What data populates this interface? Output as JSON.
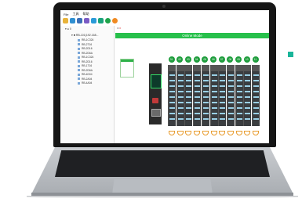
{
  "app": {
    "menu": [
      "File",
      "工具",
      "帮助"
    ],
    "toolbar_icons": [
      {
        "name": "folder-icon",
        "color": "#e8b33a"
      },
      {
        "name": "save-icon",
        "color": "#2f8fd1"
      },
      {
        "name": "monitor-icon",
        "color": "#3b6fb6"
      },
      {
        "name": "config-icon",
        "color": "#7a5bc4"
      },
      {
        "name": "device-icon",
        "color": "#2a9bd8"
      },
      {
        "name": "user-icon",
        "color": "#1aa37a"
      },
      {
        "name": "connect-icon",
        "color": "#1fa34a"
      },
      {
        "name": "disconnect-icon",
        "color": "#f08a22"
      }
    ],
    "tree": {
      "root": "0",
      "node": "RB-101(192.168...",
      "items": [
        "RB-1C324",
        "RB-2T16",
        "RB-2D16",
        "RB-2D6A",
        "RB-1C324",
        "RB-2D16",
        "RB-1T16",
        "RB-2D6A",
        "RB-4D04",
        "RB-2A04",
        "RB-4A04"
      ]
    },
    "tab_close": "x",
    "status_bar": "Online Mode",
    "slot_labels": [
      "01",
      "02",
      "03",
      "04",
      "05",
      "06",
      "07",
      "08",
      "09",
      "10",
      "11"
    ],
    "accent": "#27c04b",
    "deco_color": "#1ab59a"
  }
}
